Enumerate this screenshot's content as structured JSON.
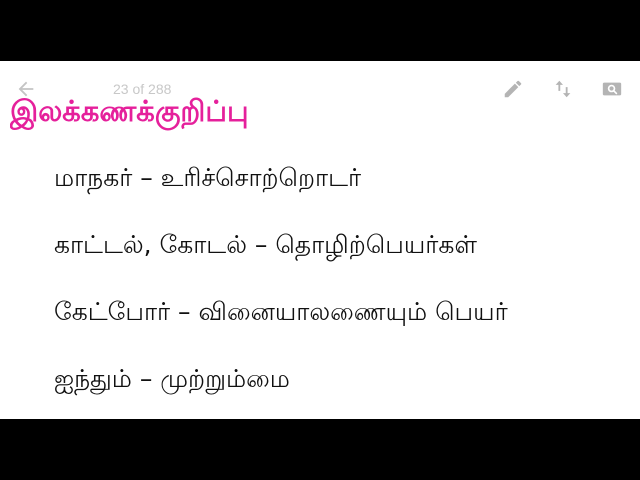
{
  "toolbar": {
    "back_icon": "arrow-left-icon",
    "page_counter": "23 of 288",
    "edit_icon": "pencil-icon",
    "sort_icon": "swap-vertical-icon",
    "search_icon": "image-search-icon",
    "icon_color": "#b4b4b4"
  },
  "content": {
    "heading": "இலக்கணக்குறிப்பு",
    "heading_color": "#e5209b",
    "lines": [
      "மாநகர் – உரிச்சொற்றொடர்",
      "காட்டல், கோடல் – தொழிற்பெயர்கள்",
      "கேட்போர் – வினையாலணையும் பெயர்",
      "ஐந்தும் – முற்றும்மை"
    ]
  }
}
